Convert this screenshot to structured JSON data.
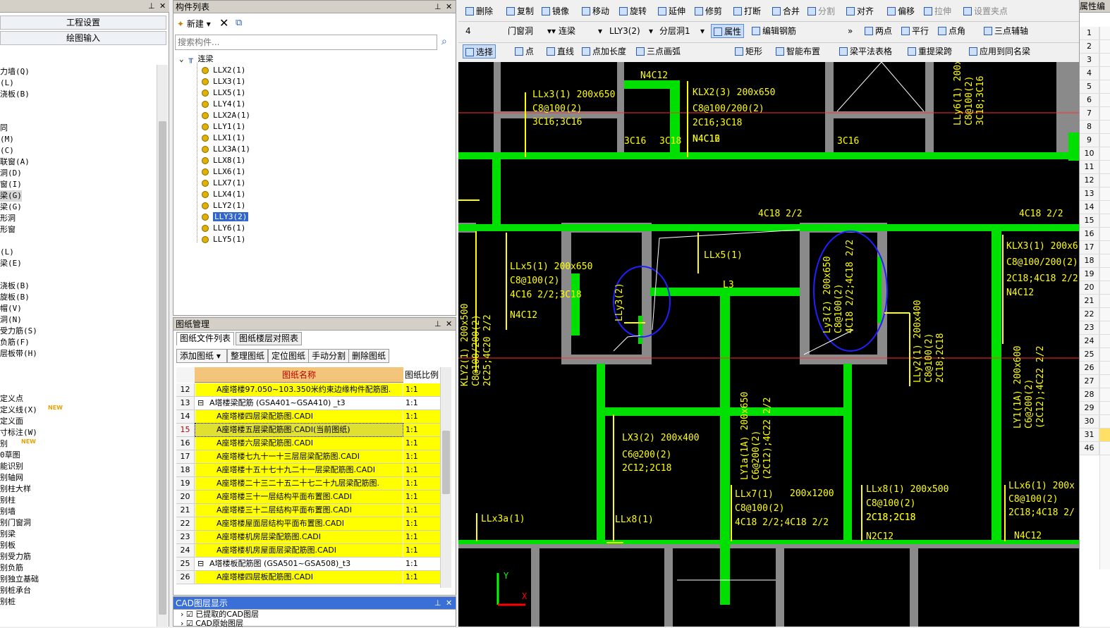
{
  "left_panel": {
    "title": "",
    "buttons": [
      "工程设置",
      "绘图输入"
    ],
    "items": [
      "力墙(Q)",
      "(L)",
      "浇板(B)",
      "",
      "",
      "同",
      "(M)",
      "(C)",
      "联窗(A)",
      "洞(D)",
      "窗(I)",
      "梁(G)",
      "梁(G)",
      "形洞",
      "形窗",
      "",
      "(L)",
      "梁(E)",
      "",
      "浇板(B)",
      "旋板(B)",
      "帽(V)",
      "洞(N)",
      "受力筋(S)",
      "负筋(F)",
      "层板带(H)",
      "",
      "",
      "",
      "定义点",
      "定义线(X)",
      "定义面",
      "寸标注(W)",
      "别",
      "0草图",
      "能识别",
      "别轴网",
      "别柱大样",
      "别柱",
      "别墙",
      "别门窗洞",
      "别梁",
      "别板",
      "别受力筋",
      "别负筋",
      "别独立基础",
      "别桩承台",
      "别桩"
    ],
    "new_tag": "NEW"
  },
  "component_list": {
    "title": "构件列表",
    "new_label": "新建",
    "search_placeholder": "搜索构件...",
    "root": "连梁",
    "items": [
      "LLX2(1)",
      "LLX3(1)",
      "LLX5(1)",
      "LLY4(1)",
      "LLX2A(1)",
      "LLY1(1)",
      "LLX1(1)",
      "LLX3A(1)",
      "LLX8(1)",
      "LLX6(1)",
      "LLX7(1)",
      "LLX4(1)",
      "LLY2(1)",
      "LLY3(2)",
      "LLY6(1)",
      "LLY5(1)"
    ],
    "selected": "LLY3(2)"
  },
  "drawing_manager": {
    "title": "图纸管理",
    "tabs": [
      "图纸文件列表",
      "图纸楼层对照表"
    ],
    "buttons": [
      "添加图纸",
      "整理图纸",
      "定位图纸",
      "手动分割",
      "删除图纸"
    ],
    "col_name": "图纸名称",
    "col_ratio": "图纸比例",
    "rows": [
      {
        "num": "12",
        "name": "A座塔楼97.050~103.350米约束边缘构件配筋图.",
        "ratio": "1:1",
        "yellow": true
      },
      {
        "num": "13",
        "name": "A塔楼梁配筋 (GSA401~GSA410) _t3",
        "ratio": "1:1",
        "yellow": false,
        "group": true
      },
      {
        "num": "14",
        "name": "A座塔楼四层梁配筋图.CADI",
        "ratio": "1:1",
        "yellow": true
      },
      {
        "num": "15",
        "name": "A座塔楼五层梁配筋图.CADI(当前图纸)",
        "ratio": "1:1",
        "yellow": true,
        "current": true
      },
      {
        "num": "16",
        "name": "A座塔楼六层梁配筋图.CADI",
        "ratio": "1:1",
        "yellow": true
      },
      {
        "num": "17",
        "name": "A座塔楼七九十一十三层层梁配筋图.CADI",
        "ratio": "1:1",
        "yellow": true
      },
      {
        "num": "18",
        "name": "A座塔楼十五十七十九二十一层梁配筋图.CADI",
        "ratio": "1:1",
        "yellow": true
      },
      {
        "num": "19",
        "name": "A座塔楼二十三二十五二十七二十九层梁配筋图.",
        "ratio": "1:1",
        "yellow": true
      },
      {
        "num": "20",
        "name": "A座塔楼三十一层结构平面布置图.CADI",
        "ratio": "1:1",
        "yellow": true
      },
      {
        "num": "21",
        "name": "A座塔楼三十二层结构平面布置图.CADI",
        "ratio": "1:1",
        "yellow": true
      },
      {
        "num": "22",
        "name": "A座塔楼屋面层结构平面布置图.CADI",
        "ratio": "1:1",
        "yellow": true
      },
      {
        "num": "23",
        "name": "A座塔楼机房层梁配筋图.CADI",
        "ratio": "1:1",
        "yellow": true
      },
      {
        "num": "24",
        "name": "A座塔楼机房屋面层梁配筋图.CADI",
        "ratio": "1:1",
        "yellow": true
      },
      {
        "num": "25",
        "name": "A塔楼板配筋图 (GSA501~GSA508)_t3",
        "ratio": "1:1",
        "yellow": false,
        "group": true
      },
      {
        "num": "26",
        "name": "A座塔楼四层板配筋图.CADI",
        "ratio": "1:1",
        "yellow": true
      }
    ]
  },
  "cad_layer": {
    "title": "CAD图层显示",
    "items": [
      "已提取的CAD图层",
      "CAD原始图层"
    ]
  },
  "toolbar1": [
    "删除",
    "复制",
    "镜像",
    "移动",
    "旋转",
    "延伸",
    "修剪",
    "打断",
    "合并",
    "分割",
    "对齐",
    "偏移",
    "拉伸",
    "设置夹点"
  ],
  "toolbar2": {
    "floor": "4",
    "category": "门窗洞",
    "type": "连梁",
    "component": "LLY3(2)",
    "layer": "分层洞1",
    "property": "属性",
    "edit_rebar": "编辑钢筋",
    "right_items": [
      "两点",
      "平行",
      "点角",
      "三点辅轴"
    ]
  },
  "toolbar3": [
    "选择",
    "点",
    "直线",
    "点加长度",
    "三点画弧",
    "矩形",
    "智能布置",
    "梁平法表格",
    "重提梁跨",
    "应用到同名梁"
  ],
  "right_panel": {
    "title": "属性编",
    "rows": [
      "1",
      "2",
      "3",
      "4",
      "5",
      "6",
      "7",
      "8",
      "9",
      "10",
      "11",
      "12",
      "13",
      "14",
      "15",
      "16",
      "17",
      "18",
      "19",
      "20",
      "21",
      "22",
      "23",
      "24",
      "25",
      "26",
      "27",
      "28",
      "29",
      "30",
      "31",
      "46"
    ]
  },
  "canvas": {
    "labels": [
      "LLx3(1) 200x650",
      "C8@100(2)",
      "3C16;3C16",
      "KLX2(3) 200x650",
      "C8@100/200(2)",
      "2C16;3C18",
      "N4C16",
      "LLx5(1) 200x650",
      "C8@100(2)",
      "4C16 2/2;3C18",
      "N4C12",
      "LLx5(1)",
      "L3",
      "KLX3(1) 200x6",
      "C8@100/200(2)",
      "2C18;4C18 2/2",
      "N4C12",
      "LX3(2) 200x400",
      "C6@200(2)",
      "2C12;2C18",
      "LLx7(1)",
      "C8@100(2)",
      "4C18 2/2;4C18 2/2",
      "200x1200",
      "LLx8(1) 200x500",
      "C8@100(2)",
      "2C18;2C18",
      "N2C12",
      "LLx6(1) 200x",
      "C8@100(2)",
      "2C18;4C18 2/",
      "LLx3a(1)",
      "LLx8(1)",
      "4C18 2/2",
      "4C18 2/2",
      "N4C12",
      "2C18;2C18",
      "N4C12",
      "3C16",
      "3C18",
      "3C16",
      "N4C12"
    ]
  }
}
